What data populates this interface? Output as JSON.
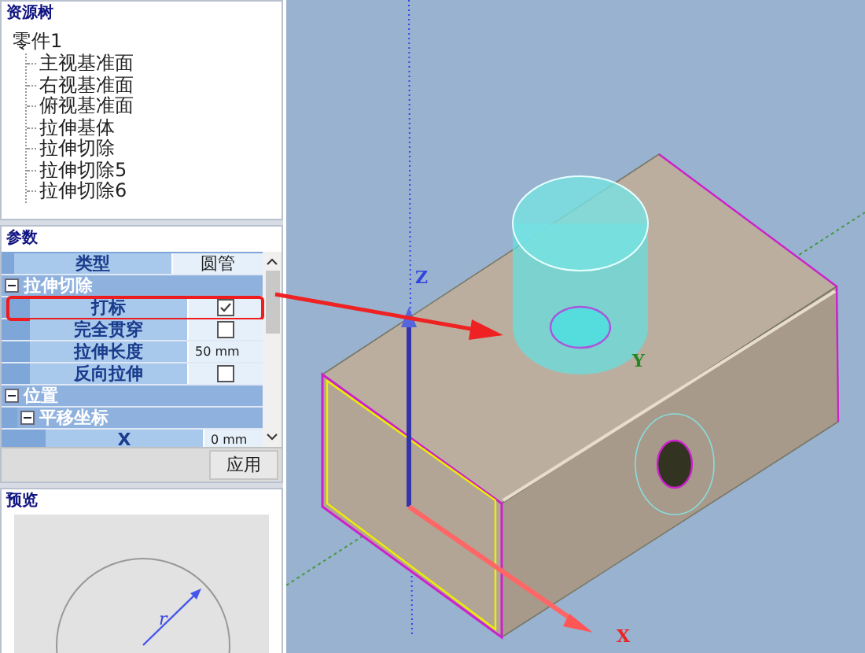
{
  "resource_tree": {
    "title": "资源树",
    "root": {
      "label": "零件1",
      "children": [
        {
          "label": "主视基准面"
        },
        {
          "label": "右视基准面"
        },
        {
          "label": "俯视基准面"
        },
        {
          "label": "拉伸基体"
        },
        {
          "label": "拉伸切除"
        },
        {
          "label": "拉伸切除5"
        },
        {
          "label": "拉伸切除6"
        }
      ]
    }
  },
  "parameters": {
    "title": "参数",
    "rows": [
      {
        "kind": "value",
        "label": "类型",
        "value": "圆管"
      },
      {
        "kind": "group",
        "label": "拉伸切除",
        "expanded": true,
        "children": [
          {
            "kind": "check",
            "label": "打标",
            "checked": true,
            "highlighted": true
          },
          {
            "kind": "check",
            "label": "完全贯穿",
            "checked": false,
            "highlighted": false
          },
          {
            "kind": "value",
            "label": "拉伸长度",
            "value": "50 mm"
          },
          {
            "kind": "check",
            "label": "反向拉伸",
            "checked": false,
            "highlighted": false
          }
        ]
      },
      {
        "kind": "group",
        "label": "位置",
        "expanded": true,
        "children": [
          {
            "kind": "group",
            "label": "平移坐标",
            "expanded": true,
            "children": [
              {
                "kind": "value",
                "label": "X",
                "value": "0 mm"
              }
            ]
          }
        ]
      }
    ],
    "apply_button": "应用"
  },
  "preview": {
    "title": "预览",
    "radius_label": "r"
  },
  "viewport": {
    "axis_labels": [
      "Z",
      "Y",
      "X"
    ]
  }
}
